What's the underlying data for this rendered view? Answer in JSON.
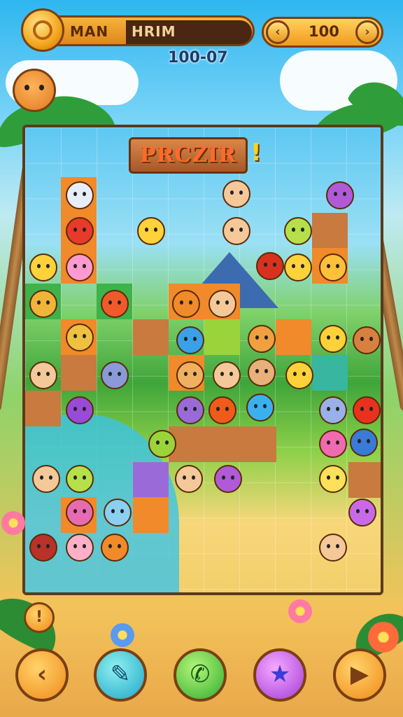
{
  "header": {
    "player_label": "MAN",
    "level_label": "HRIM",
    "score": "100",
    "timer": "100-07",
    "back_small_icon": "left-arrow-icon",
    "forward_small_icon": "right-arrow-icon"
  },
  "board": {
    "title": "PRCZIR",
    "title_mark": "!"
  },
  "controls": {
    "info_glyph": "!",
    "buttons": [
      {
        "icon": "back-icon",
        "glyph": "‹"
      },
      {
        "icon": "hint-icon",
        "glyph": "✎"
      },
      {
        "icon": "phone-icon",
        "glyph": "✆"
      },
      {
        "icon": "star-icon",
        "glyph": "★"
      },
      {
        "icon": "play-icon",
        "glyph": "▶"
      }
    ]
  },
  "colors": {
    "accent": "#f08a1a",
    "frame": "#5b3a1c",
    "sky": "#2fb6f0"
  }
}
